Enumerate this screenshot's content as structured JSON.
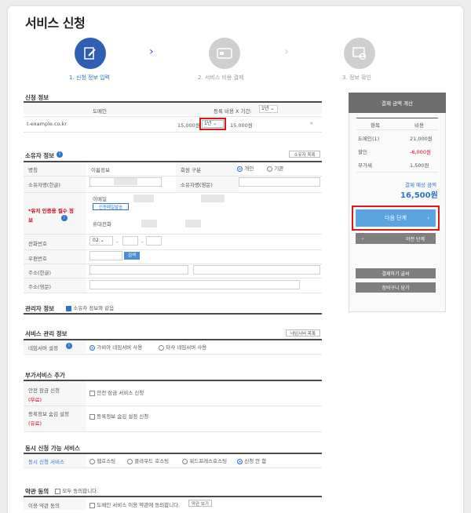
{
  "page": {
    "title": "서비스 신청"
  },
  "steps": [
    {
      "label": "1. 신청 정보 입력"
    },
    {
      "label": "2. 서비스 비용 결제"
    },
    {
      "label": "3. 정보 확인"
    }
  ],
  "application_info": {
    "title": "신청 정보",
    "col_domain": "도메인",
    "col_cost": "등록 비용 X 기간:",
    "period_select": "1년",
    "domain": "t-example.co.kr",
    "price": "15,000원",
    "row_period": "1년",
    "total": "15,000원",
    "remove": "×"
  },
  "owner_info": {
    "title": "소유자 정보",
    "load_btn": "소유자 목록",
    "type_label": "명칭",
    "type_value": "이름정보",
    "member_label": "회원 구분",
    "member_opt1": "개인",
    "member_opt2": "기관",
    "name_kr_label": "소유자명(한글)",
    "name_en_label": "소유자명(영문)",
    "auth_label": "*유저 인증용 필수 정보",
    "email_label": "이메일",
    "email_btn": "인증메일발송",
    "phone_mobile_label": "휴대전화",
    "tel_label": "전화번호",
    "tel_prefix": "02",
    "zip_label": "우편번호",
    "zip_btn": "검색",
    "addr_kr_label": "주소(한글)",
    "addr_en_label": "주소(영문)"
  },
  "admin_info": {
    "title": "관리자 정보",
    "same_label": "소유자 정보와 같음"
  },
  "service_mgmt": {
    "title": "서비스 관리 정보",
    "btn": "네임서버 목록",
    "ns_label": "네임서버 설정",
    "ns_opt1": "가비아 네임서버 사용",
    "ns_opt2": "타사 네임서버 사용"
  },
  "addon": {
    "title": "부가서비스 추가",
    "safe_label": "안전 잠금 신청",
    "safe_tag": "(무료)",
    "safe_opt": "안전 잠금 서비스 신청",
    "privacy_label": "등록정보 숨김 설정",
    "privacy_tag": "(유료)",
    "privacy_opt": "등록정보 숨김 설정 신청"
  },
  "concurrent": {
    "title": "동시 신청 가능 서비스",
    "label": "동시 신청 서비스",
    "opt1": "웹호스팅",
    "opt2": "클라우드 호스팅",
    "opt3": "워드프레스호스팅",
    "opt4": "신청 안 함"
  },
  "terms": {
    "title": "약관 동의",
    "all_label": "모두 동의합니다.",
    "row_label": "이용 약관 동의",
    "row_opt": "도메인 서비스 이용 약관에 동의합니다.",
    "view_btn": "약관 보기"
  },
  "sidebar": {
    "header": "결제 금액 계산",
    "col_item": "항목",
    "col_cost": "비용",
    "rows": [
      {
        "name": "도메인(1)",
        "value": "21,000원"
      },
      {
        "name": "할인",
        "value": "-6,000원"
      },
      {
        "name": "부가세",
        "value": "1,500원"
      }
    ],
    "total_label": "결제 예상 금액",
    "total_value": "16,500원",
    "next_btn": "다음 단계",
    "prev_btn": "이전 단계",
    "btn_a": "결제하기 글씨",
    "btn_b": "장바구니 담기"
  },
  "colors": {
    "accent": "#2f73c8",
    "highlight": "#e0161b",
    "step_active": "#2f5fb5"
  }
}
